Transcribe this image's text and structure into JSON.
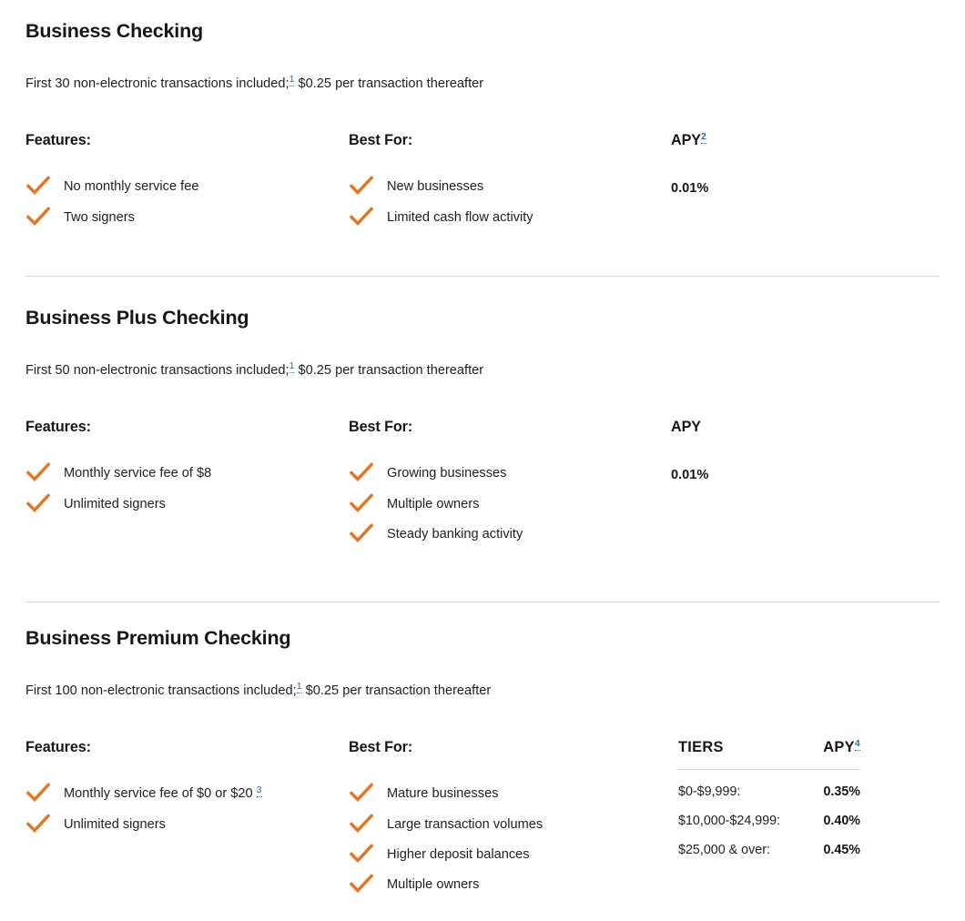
{
  "colors": {
    "check": "#E8731C",
    "footnote_link": "#2a6ebb",
    "divider": "#d8d8d8",
    "text": "#1f1f1f",
    "heading": "#17171a"
  },
  "products": [
    {
      "title": "Business Checking",
      "note_prefix": "First 30 non-electronic transactions included;",
      "note_footnote": "1",
      "note_suffix": "$0.25 per transaction thereafter",
      "features_heading": "Features:",
      "features": [
        "No monthly service fee",
        "Two signers"
      ],
      "bestfor_heading": "Best For:",
      "bestfor": [
        "New businesses",
        "Limited cash flow activity"
      ],
      "apy_heading": "APY",
      "apy_footnote": "2",
      "apy_value": "0.01%"
    },
    {
      "title": "Business Plus Checking",
      "note_prefix": "First 50 non-electronic transactions included;",
      "note_footnote": "1",
      "note_suffix": "$0.25 per transaction thereafter",
      "features_heading": "Features:",
      "features": [
        "Monthly service fee of $8",
        "Unlimited signers"
      ],
      "bestfor_heading": "Best For:",
      "bestfor": [
        "Growing businesses",
        "Multiple owners",
        "Steady banking activity"
      ],
      "apy_heading": "APY",
      "apy_footnote": "",
      "apy_value": "0.01%"
    },
    {
      "title": "Business Premium Checking",
      "note_prefix": "First 100 non-electronic transactions included;",
      "note_footnote": "1",
      "note_suffix": "$0.25 per transaction thereafter",
      "features_heading": "Features:",
      "features": [
        "Monthly service fee of $0 or $20",
        "Unlimited signers"
      ],
      "features_footnotes": [
        "3",
        ""
      ],
      "bestfor_heading": "Best For:",
      "bestfor": [
        "Mature businesses",
        "Large transaction volumes",
        "Higher deposit balances",
        "Multiple owners"
      ],
      "tiers_table": {
        "headers": [
          "TIERS",
          "APY"
        ],
        "apy_footnote": "4",
        "rows": [
          {
            "tier": "$0-$9,999:",
            "apy": "0.35%"
          },
          {
            "tier": "$10,000-$24,999:",
            "apy": "0.40%"
          },
          {
            "tier": "$25,000 & over:",
            "apy": "0.45%"
          }
        ]
      }
    }
  ],
  "icons": {
    "check": "check-icon"
  }
}
